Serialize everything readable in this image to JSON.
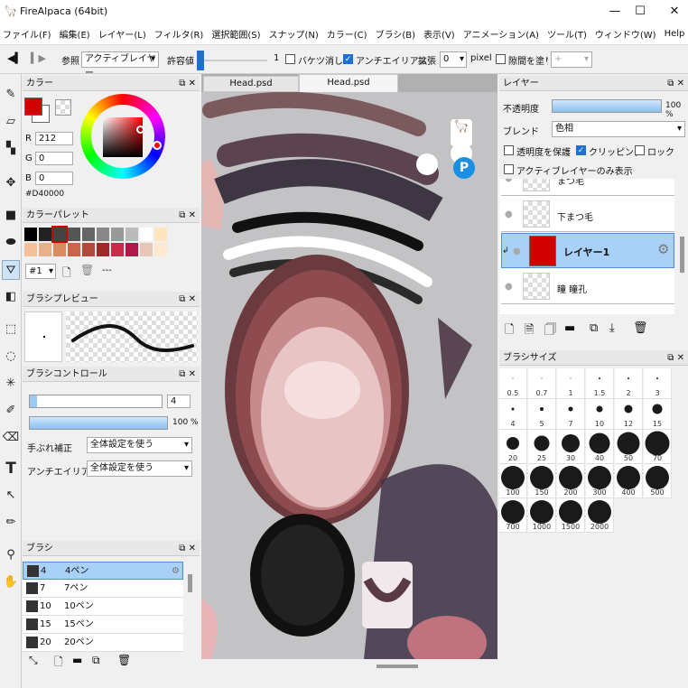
{
  "window": {
    "title": "FireAlpaca (64bit)",
    "min": "—",
    "max": "☐",
    "close": "✕"
  },
  "menu": [
    "ファイル(F)",
    "編集(E)",
    "レイヤー(L)",
    "フィルタ(R)",
    "選択範囲(S)",
    "スナップ(N)",
    "カラー(C)",
    "ブラシ(B)",
    "表示(V)",
    "アニメーション(A)",
    "ツール(T)",
    "ウィンドウ(W)",
    "Help"
  ],
  "toolbar": {
    "ref_label": "参照",
    "ref_value": "アクティブレイヤー",
    "tolerance_label": "許容値",
    "tolerance_value": "1",
    "bucket_label": "バケツ消し",
    "antialias_label": "アンチエイリアス",
    "expand_label": "拡張",
    "expand_value": "0",
    "pixel_label": "pixel",
    "gap_label": "隙間を塗り"
  },
  "tabs": [
    "Head.psd",
    "Head.psd"
  ],
  "color_panel": {
    "title": "カラー",
    "r_label": "R",
    "r": "212",
    "g_label": "G",
    "g": "0",
    "b_label": "B",
    "b": "0",
    "hex": "#D40000",
    "current_color": "#D40000"
  },
  "palette_panel": {
    "title": "カラーパレット",
    "selector": "#1",
    "dashes": "---",
    "swatches": [
      "#000000",
      "#222222",
      "#444444",
      "#555555",
      "#666666",
      "#888888",
      "#999999",
      "#bbbbbb",
      "#ffffff",
      "#fde5c0",
      "#f3c09a",
      "#e8b18a",
      "#d98d5e",
      "#c96848",
      "#b04a3a",
      "#9c2a2a",
      "#c92c4b",
      "#b1184a",
      "#e6c6b6",
      "#fde8d0"
    ]
  },
  "brush_preview": {
    "title": "ブラシプレビュー"
  },
  "brush_control": {
    "title": "ブラシコントロール",
    "size": "4",
    "opacity": "100 %",
    "stab_label": "手ぶれ補正",
    "stab_value": "全体設定を使う",
    "aa_label": "アンチエイリアス",
    "aa_value": "全体設定を使う"
  },
  "brush_list": {
    "title": "ブラシ",
    "items": [
      {
        "size": "4",
        "name": "4ペン"
      },
      {
        "size": "7",
        "name": "7ペン"
      },
      {
        "size": "10",
        "name": "10ペン"
      },
      {
        "size": "15",
        "name": "15ペン"
      },
      {
        "size": "20",
        "name": "20ペン"
      }
    ]
  },
  "layer_panel": {
    "title": "レイヤー",
    "opacity_label": "不透明度",
    "opacity_value": "100 %",
    "blend_label": "ブレンド",
    "blend_value": "色相",
    "protect_label": "透明度を保護",
    "clip_label": "クリッピング",
    "lock_label": "ロック",
    "active_only_label": "アクティブレイヤーのみ表示",
    "layers": [
      {
        "name": "まつ毛"
      },
      {
        "name": "下まつ毛"
      },
      {
        "name": "レイヤー1"
      },
      {
        "name": "瞳 瞳孔"
      }
    ]
  },
  "brush_size_panel": {
    "title": "ブラシサイズ",
    "sizes": [
      "0.5",
      "0.7",
      "1",
      "1.5",
      "2",
      "3",
      "4",
      "5",
      "7",
      "10",
      "12",
      "15",
      "20",
      "25",
      "30",
      "40",
      "50",
      "70",
      "100",
      "150",
      "200",
      "300",
      "400",
      "500",
      "700",
      "1000",
      "1500",
      "2000"
    ]
  },
  "canvas_badges": {
    "p": "P"
  }
}
